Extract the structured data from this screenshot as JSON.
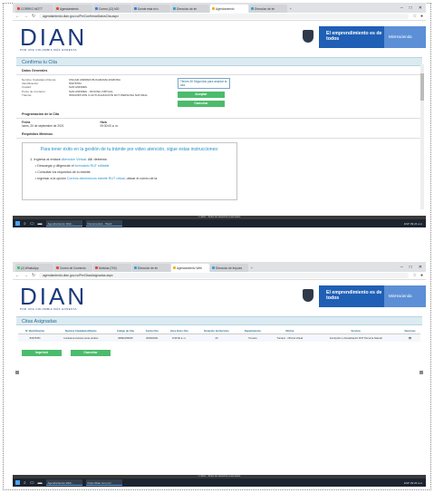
{
  "shot1": {
    "tabs": [
      "CORREO MOTT",
      "Agendamiento",
      "Correo (12) MO",
      "Donde esta mi c",
      "Direccion de Im",
      "Agendamiento",
      "Direccion de Im",
      "+"
    ],
    "url": "agendamiento.dian.gov.co/PerConfirmarDatosCita.aspx",
    "logo_text": "DIAN",
    "logo_sub": "POR UNA COLOMBIA MÁS HONESTA",
    "banner": "El emprendimiento es de todos",
    "ministry": "MinHacienda",
    "page_title": "Confirma tu Cita",
    "datos_title": "Datos Generales",
    "rows": [
      {
        "label": "Nombre Ciudadano/Cliente:",
        "value": "OSCAR ANDRES BUCARAMA ZAMORA"
      },
      {
        "label": "Identificación:",
        "value": "83476784"
      },
      {
        "label": "Ciudad:",
        "value": "SAN ANDRES"
      },
      {
        "label": "Punto de Contacto:",
        "value": "SAN ANDRES - OFICINA VIRTUAL"
      },
      {
        "label": "Trámite:",
        "value": "INSCRIPCIÓN O ACTUALIZACIÓN RUT PERSONA NATURAL"
      }
    ],
    "timer_text": "Tienes 45 Segundos para aceptar la cita.",
    "accept_label": "Aceptar",
    "cancel_label": "Cancelar",
    "prog_title": "Programación de la Cita",
    "fecha_label": "Fecha",
    "fecha_value": "lunes, 20 de septiembre de 2021",
    "hora_label": "Hora",
    "hora_value": "09:30:00 a. m.",
    "req_title": "Requisitos Mínimos",
    "req_box_title": "Para tener éxito en la gestión de tu trámite por video atención, sigue estas instrucciones:",
    "req_step1_a": "1. Ingresa al enlace ",
    "req_step1_link": "Atención Virtual",
    "req_step1_b": ". Allí deberás:",
    "bullet1_a": "Descargar y diligenciar el ",
    "bullet1_link": "formulario RUT editable",
    "bullet2": "Consultar los requisitos de tu trámite.",
    "bullet3_a": "Ingresar a la opción ",
    "bullet3_link": "Correos electrónicos trámite RUT virtual",
    "bullet3_b": ", ubicar el correo de la",
    "status_strip": "© 2021 - Todos los derechos reservados",
    "taskbar_apps": [
      "Agendamiento Web...",
      "Documento1 - Word"
    ],
    "tray": "ESP 09:24 a.m."
  },
  "shot2": {
    "tabs": [
      "(2) WhatsApp",
      "Correo de Comercio",
      "Noticias (700)",
      "Direccion de Im",
      "Agendamiento Web",
      "Direccion de Impues",
      "+"
    ],
    "url": "agendamiento.dian.gov.co/PerCitasAsignadas.aspx",
    "page_title": "Citas Asignadas",
    "headers": [
      "N° Identificación",
      "Nombre Ciudadano/Cliente",
      "Código de Cita",
      "Fecha Cita",
      "Hora Inicio Cita",
      "Duración del Servicio",
      "Departamento",
      "Oficina",
      "Servicio",
      "Opciones"
    ],
    "row": [
      "83476784",
      "bucarama zamora oscar andres",
      "30892169645",
      "20/09/2021",
      "9:30:00 a. m.",
      "20",
      "Tumaco",
      "Tumaco - Oficina Virtual",
      "Inscripción o Actualización RUT Persona Natural",
      "👁"
    ],
    "print_label": "Imprimir",
    "cancel_label": "Cancelar",
    "status_strip": "© 2021 - Todos los derechos reservados",
    "taskbar_apps": [
      "Agendamiento Web...",
      "https://dian.com.co/"
    ],
    "tray": "ESP 09:26 a.m."
  },
  "colors": {
    "accent": "#1f8fc6",
    "brand": "#1a3a7c",
    "button": "#4cbb6c"
  }
}
